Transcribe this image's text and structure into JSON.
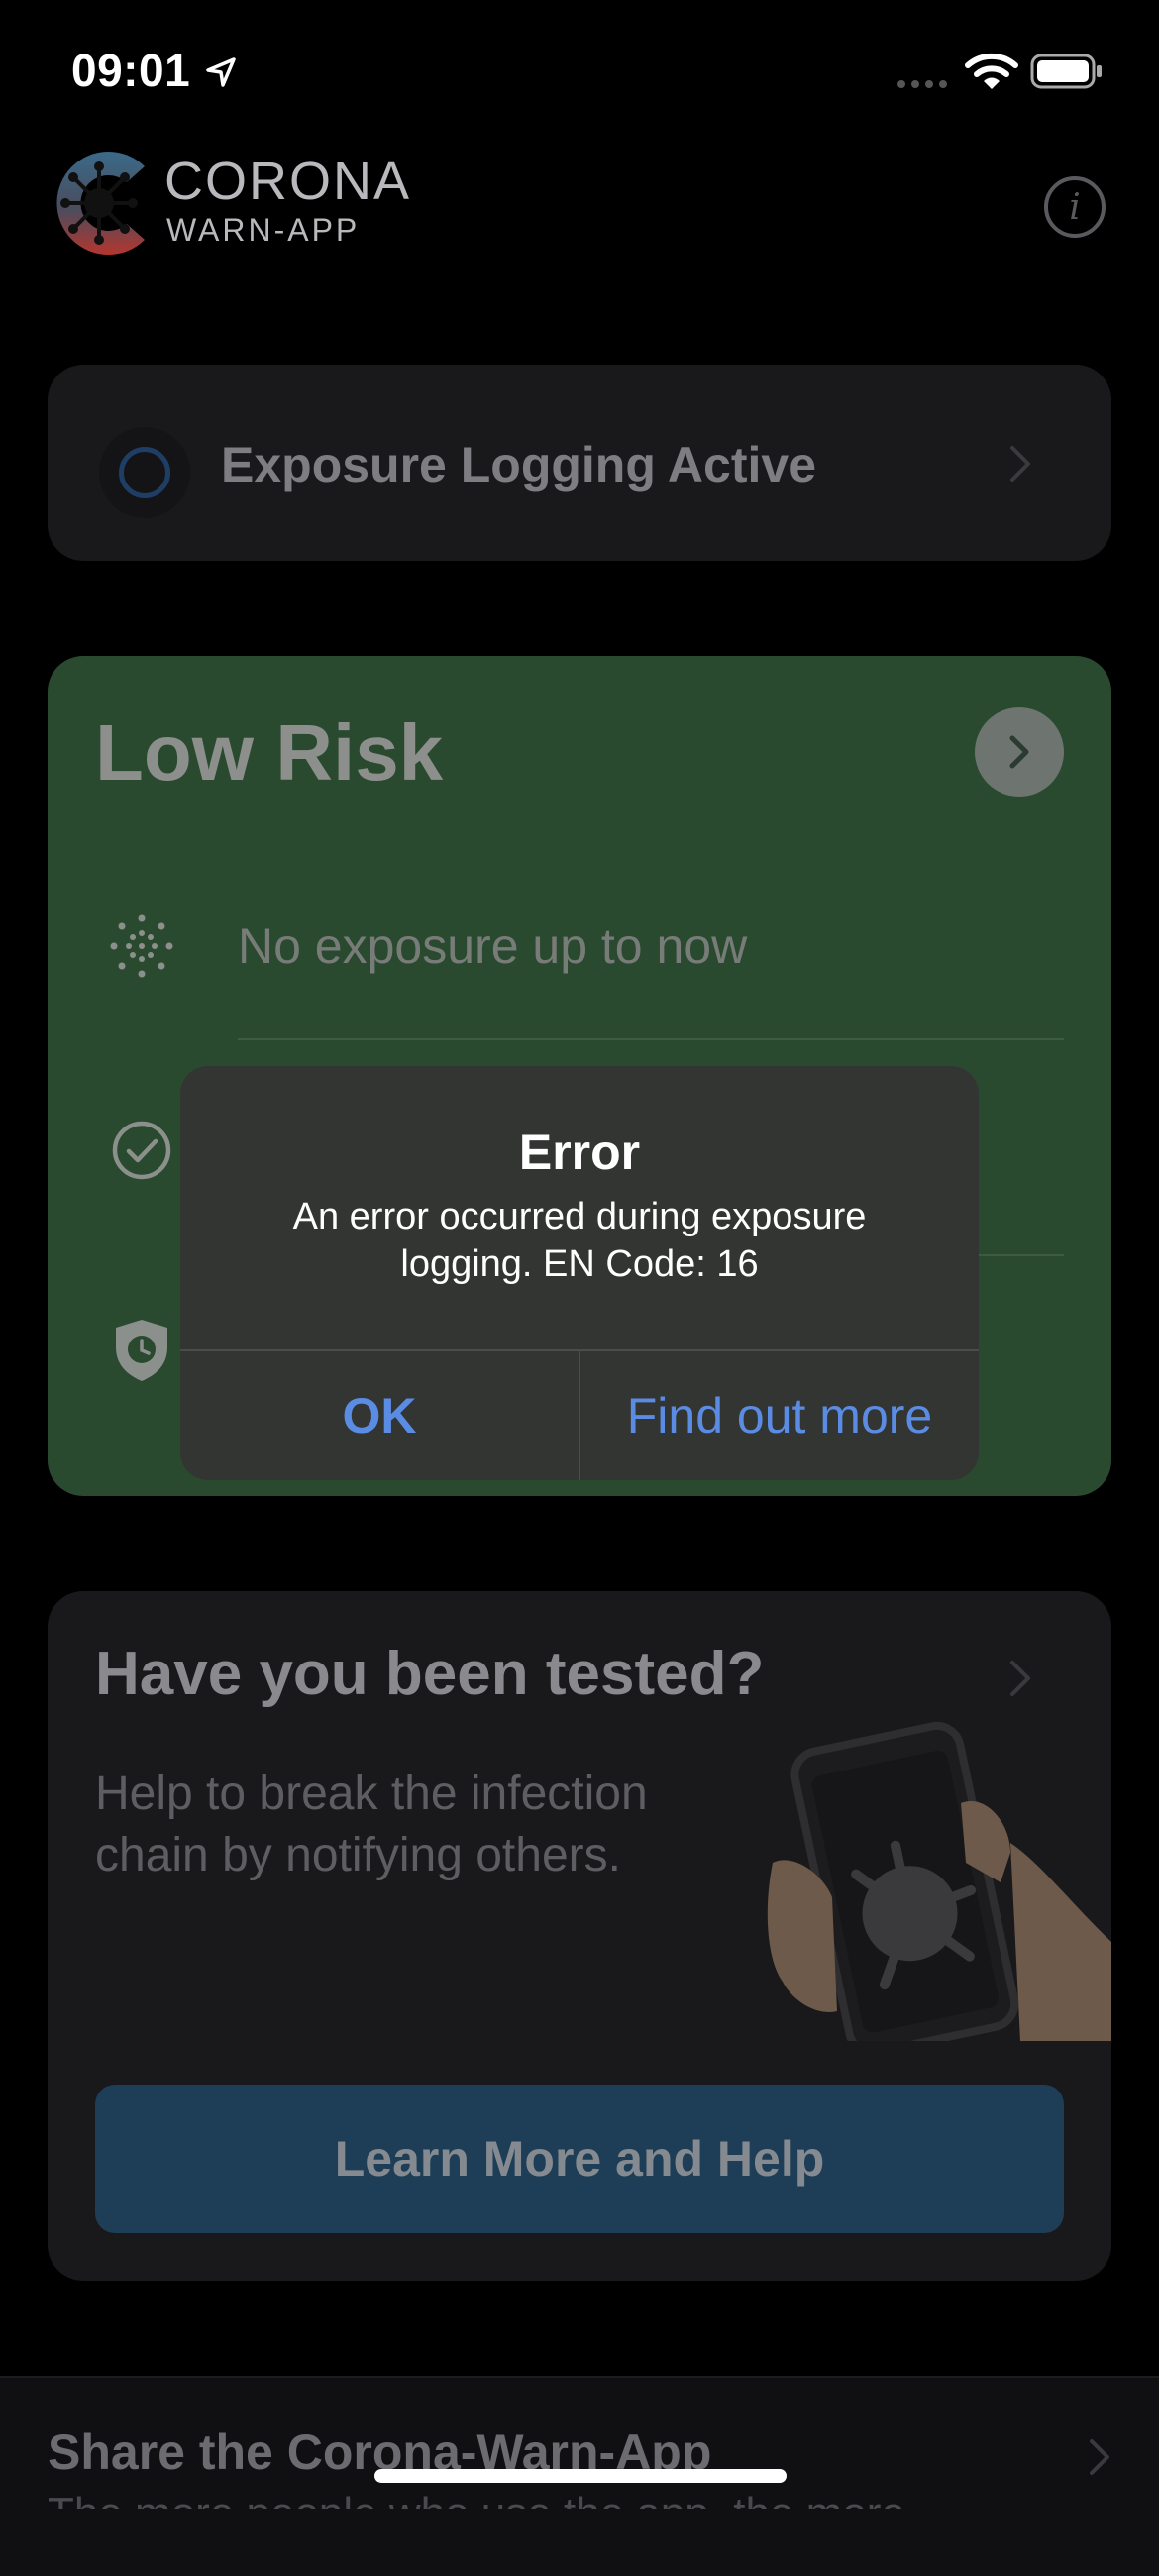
{
  "status_bar": {
    "time": "09:01",
    "icons": [
      "location-arrow-icon",
      "cellular-signal-icon",
      "wifi-icon",
      "battery-icon"
    ]
  },
  "header": {
    "brand_title": "CORONA",
    "brand_subtitle": "WARN-APP",
    "info_icon": "i"
  },
  "exposure_card": {
    "label": "Exposure Logging Active"
  },
  "risk_card": {
    "title": "Low Risk",
    "line1": "No exposure up to now",
    "background": "#2a4a2f"
  },
  "alert": {
    "title": "Error",
    "message": "An error occurred during exposure logging. EN Code: 16",
    "ok_label": "OK",
    "more_label": "Find out more",
    "button_color": "#5b8ce4"
  },
  "tested_card": {
    "title": "Have you been tested?",
    "body": "Help to break the infection chain by notifying others.",
    "button_label": "Learn More and Help"
  },
  "share_card": {
    "title": "Share the Corona-Warn-App",
    "subtitle": "The more people who use the app, the more effective"
  }
}
